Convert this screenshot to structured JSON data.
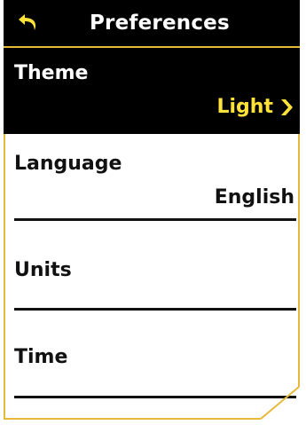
{
  "header": {
    "title": "Preferences",
    "back_icon": "back-arrow-icon"
  },
  "items": [
    {
      "label": "Theme",
      "value": "Light",
      "selected": true,
      "icon": "chevron-right-icon"
    },
    {
      "label": "Language",
      "value": "English",
      "selected": false
    },
    {
      "label": "Units",
      "value": "",
      "selected": false
    },
    {
      "label": "Time",
      "value": "",
      "selected": false
    }
  ],
  "colors": {
    "header_bg": "#000000",
    "selected_bg": "#000000",
    "accent": "#ffe33a",
    "border": "#e6b93a",
    "text": "#111111",
    "header_text": "#ffffff"
  }
}
